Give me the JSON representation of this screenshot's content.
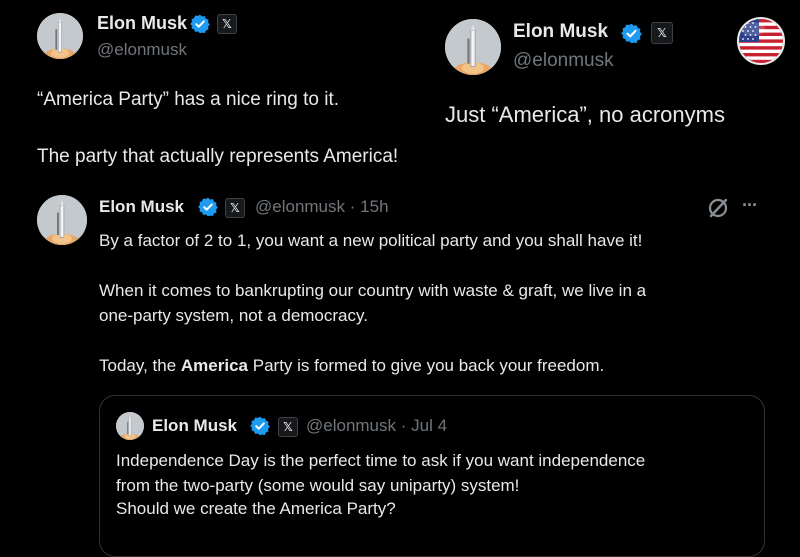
{
  "post1": {
    "name": "Elon Musk",
    "handle": "@elonmusk",
    "line1": "“America Party” has a nice ring to it.",
    "line2": "The party that actually represents America!"
  },
  "post2": {
    "name": "Elon Musk",
    "handle": "@elonmusk",
    "text": "Just “America”, no acronyms"
  },
  "post3": {
    "name": "Elon Musk",
    "handle": "@elonmusk",
    "separator": "·",
    "time": "15h",
    "para1": "By a factor of 2 to 1, you want a new political party and you shall have it!",
    "para2_line1": "When it comes to bankrupting our country with waste & graft, we live in a",
    "para2_line2": "one-party system, not a democracy.",
    "para3_pre": "Today, the ",
    "para3_bold": "America",
    "para3_post": " Party is formed to give you back your freedom."
  },
  "quote": {
    "name": "Elon Musk",
    "handle": "@elonmusk",
    "separator": "·",
    "time": "Jul 4",
    "line1": "Independence Day is the perfect time to ask if you want independence",
    "line2": "from the two-party (some would say uniparty) system!",
    "line3": "Should we create the America Party?"
  },
  "badges": {
    "x_label": "𝕏",
    "more_label": "···"
  },
  "colors": {
    "verified": "#1d9bf0",
    "background": "#000000",
    "text": "#e7e9ea",
    "muted": "#71767b"
  }
}
